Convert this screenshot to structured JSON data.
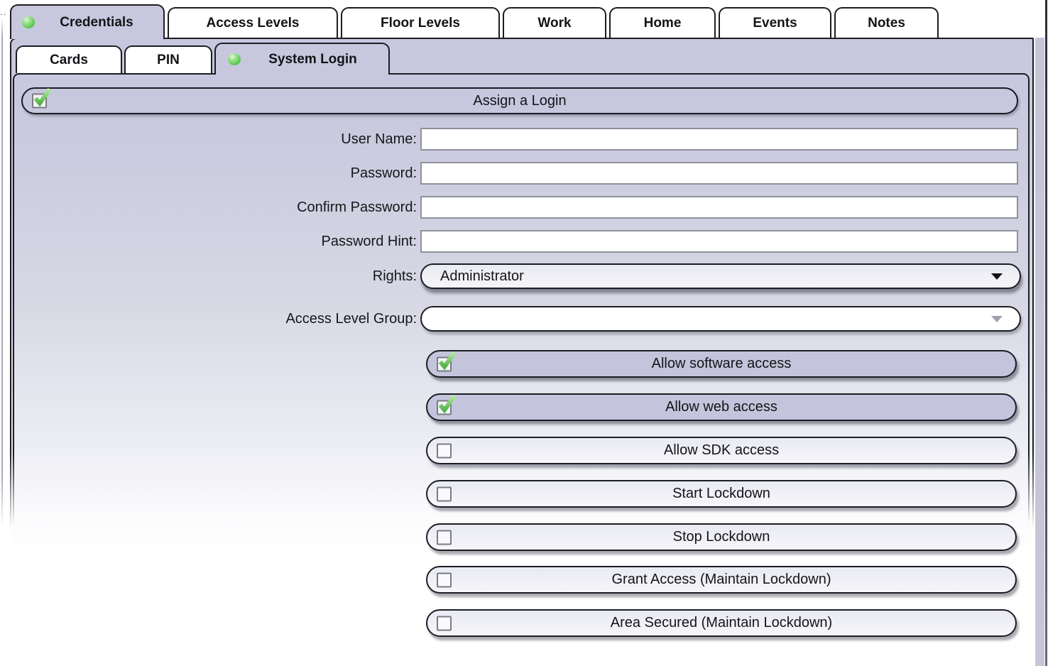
{
  "window": {
    "edge_artifact": ".."
  },
  "colors": {
    "lavender": "#c7c8de",
    "panel_border": "#1c1c24",
    "status_dot_green": "#58c44f",
    "checkmark_green": "#6cc85c"
  },
  "tabs": [
    {
      "label": "Credentials",
      "active": true,
      "has_status_dot": true
    },
    {
      "label": "Access Levels",
      "active": false
    },
    {
      "label": "Floor Levels",
      "active": false
    },
    {
      "label": "Work",
      "active": false
    },
    {
      "label": "Home",
      "active": false
    },
    {
      "label": "Events",
      "active": false
    },
    {
      "label": "Notes",
      "active": false
    }
  ],
  "subtabs": [
    {
      "label": "Cards",
      "active": false
    },
    {
      "label": "PIN",
      "active": false
    },
    {
      "label": "System Login",
      "active": true,
      "has_status_dot": true
    }
  ],
  "login_form": {
    "assign_login": {
      "label": "Assign a Login",
      "checked": true
    },
    "fields": [
      {
        "label": "User Name:",
        "value": ""
      },
      {
        "label": "Password:",
        "value": ""
      },
      {
        "label": "Confirm Password:",
        "value": ""
      },
      {
        "label": "Password Hint:",
        "value": ""
      }
    ],
    "rights": {
      "label": "Rights:",
      "value": "Administrator"
    },
    "access_level_group": {
      "label": "Access Level Group:",
      "value": ""
    }
  },
  "permissions": [
    {
      "label": "Allow software access",
      "checked": true
    },
    {
      "label": "Allow web access",
      "checked": true
    },
    {
      "label": "Allow SDK access",
      "checked": false
    },
    {
      "label": "Start Lockdown",
      "checked": false
    },
    {
      "label": "Stop Lockdown",
      "checked": false
    },
    {
      "label": "Grant Access (Maintain Lockdown)",
      "checked": false
    },
    {
      "label": "Area Secured (Maintain Lockdown)",
      "checked": false
    }
  ]
}
